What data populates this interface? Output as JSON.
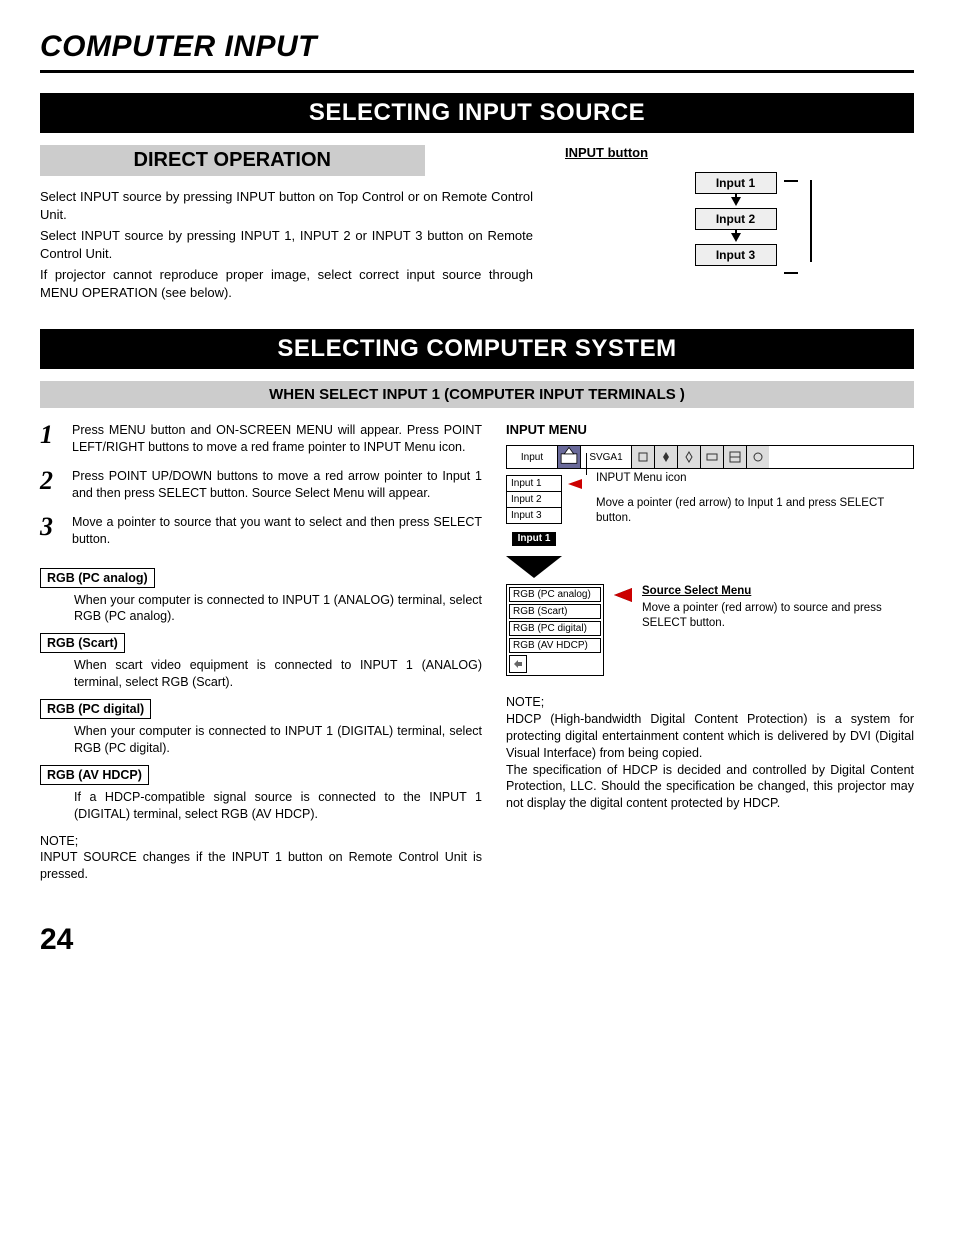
{
  "page_title": "COMPUTER INPUT",
  "banner1": "SELECTING INPUT SOURCE",
  "direct_op_heading": "DIRECT OPERATION",
  "direct_op_p1": "Select INPUT source by pressing INPUT button on Top Control or on Remote Control Unit.",
  "direct_op_p2": "Select INPUT source by pressing INPUT 1, INPUT 2 or INPUT 3 button on Remote Control Unit.",
  "direct_op_p3": "If projector cannot reproduce proper image, select correct input source through MENU OPERATION (see below).",
  "input_button_label": "INPUT button",
  "inputs": [
    "Input 1",
    "Input 2",
    "Input 3"
  ],
  "banner2": "SELECTING COMPUTER SYSTEM",
  "when_select_heading": "WHEN SELECT  INPUT 1 (COMPUTER INPUT TERMINALS )",
  "steps": [
    "Press MENU button and ON-SCREEN MENU will appear.  Press POINT LEFT/RIGHT buttons to move a red frame pointer to INPUT Menu icon.",
    "Press POINT UP/DOWN buttons to move a red arrow pointer to Input 1 and then press SELECT button.  Source Select Menu will appear.",
    "Move a pointer to source that you want to select and then press SELECT button."
  ],
  "rgb_sections": [
    {
      "label": "RGB (PC analog)",
      "text": "When your computer is connected to INPUT 1 (ANALOG) terminal, select RGB (PC analog)."
    },
    {
      "label": "RGB (Scart)",
      "text": "When scart video equipment is connected to INPUT 1 (ANALOG) terminal, select RGB (Scart)."
    },
    {
      "label": "RGB (PC digital)",
      "text": "When your computer is connected to INPUT 1 (DIGITAL) terminal, select RGB (PC digital)."
    },
    {
      "label": "RGB (AV HDCP)",
      "text": "If a HDCP-compatible signal source is connected to the INPUT 1 (DIGITAL) terminal, select RGB (AV HDCP)."
    }
  ],
  "left_note_label": "NOTE;",
  "left_note": "INPUT SOURCE changes if the INPUT 1 button on Remote Control Unit is pressed.",
  "input_menu_title": "INPUT MENU",
  "osd": {
    "top_label": "Input",
    "mode": "SVGA1",
    "side_rows": [
      "Input 1",
      "Input 2",
      "Input 3"
    ],
    "arrow_label": "Input 1",
    "menu_icon_label": "INPUT Menu icon",
    "move_pointer_text": "Move a pointer (red arrow) to Input 1 and press SELECT button.",
    "source_menu_title": "Source Select Menu",
    "source_menu_text": "Move a pointer (red arrow) to source and press SELECT button.",
    "source_rows": [
      "RGB (PC analog)",
      "RGB (Scart)",
      "RGB (PC digital)",
      "RGB (AV HDCP)"
    ]
  },
  "hdcp_note_label": "NOTE;",
  "hdcp_note": "HDCP (High-bandwidth Digital Content Protection) is a system for protecting digital entertainment content which is delivered by DVI (Digital Visual Interface) from being copied.\nThe specification of HDCP is decided and controlled by Digital Content Protection, LLC. Should the specification be changed, this projector may not display the digital content protected by HDCP.",
  "page_number": "24"
}
